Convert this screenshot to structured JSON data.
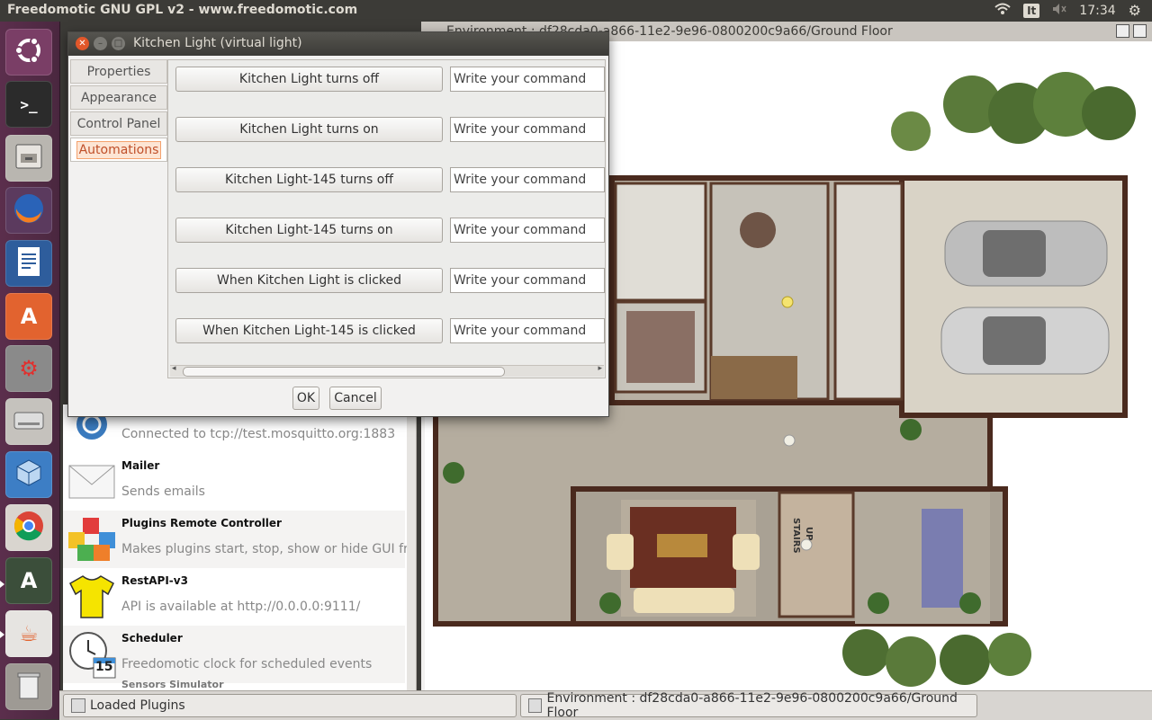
{
  "topbar": {
    "title": "Freedomotic GNU GPL v2 - www.freedomotic.com",
    "keyboard": "It",
    "time": "17:34"
  },
  "environment_window": {
    "title": "Environment : df28cda0-a866-11e2-9e96-0800200c9a66/Ground Floor"
  },
  "floorplan_labels": {
    "stairs": "STAIRS",
    "up": "UP"
  },
  "dialog": {
    "title": "Kitchen Light (virtual light)",
    "tabs": [
      {
        "label": "Properties"
      },
      {
        "label": "Appearance"
      },
      {
        "label": "Control Panel"
      },
      {
        "label": "Automations"
      }
    ],
    "automations": [
      {
        "trigger": "Kitchen Light turns off",
        "command_placeholder": "Write your command"
      },
      {
        "trigger": "Kitchen Light turns on",
        "command_placeholder": "Write your command"
      },
      {
        "trigger": "Kitchen Light-145 turns off",
        "command_placeholder": "Write your command"
      },
      {
        "trigger": "Kitchen Light-145 turns on",
        "command_placeholder": "Write your command"
      },
      {
        "trigger": "When Kitchen Light is clicked",
        "command_placeholder": "Write your command"
      },
      {
        "trigger": "When Kitchen Light-145 is clicked",
        "command_placeholder": "Write your command"
      }
    ],
    "ok_label": "OK",
    "cancel_label": "Cancel"
  },
  "plugins": {
    "partial_connected": "Connected to tcp://test.mosquitto.org:1883",
    "items": [
      {
        "name": "Mailer",
        "description": "Sends emails"
      },
      {
        "name": "Plugins Remote Controller",
        "description": "Makes plugins start, stop, show or hide GUI fro"
      },
      {
        "name": "RestAPI-v3",
        "description": "API is available at http://0.0.0.0:9111/"
      },
      {
        "name": "Scheduler",
        "description": "Freedomotic clock for scheduled events"
      },
      {
        "name": "Sensors Simulator",
        "description": ""
      }
    ],
    "scheduler_day": "15"
  },
  "taskbar": {
    "items": [
      {
        "label": "Loaded Plugins"
      },
      {
        "label": "Environment : df28cda0-a866-11e2-9e96-0800200c9a66/Ground Floor"
      }
    ]
  },
  "colors": {
    "accent_orange": "#f4a26e",
    "launcher": "#5b2e4c",
    "panel": "#3c3b37"
  }
}
